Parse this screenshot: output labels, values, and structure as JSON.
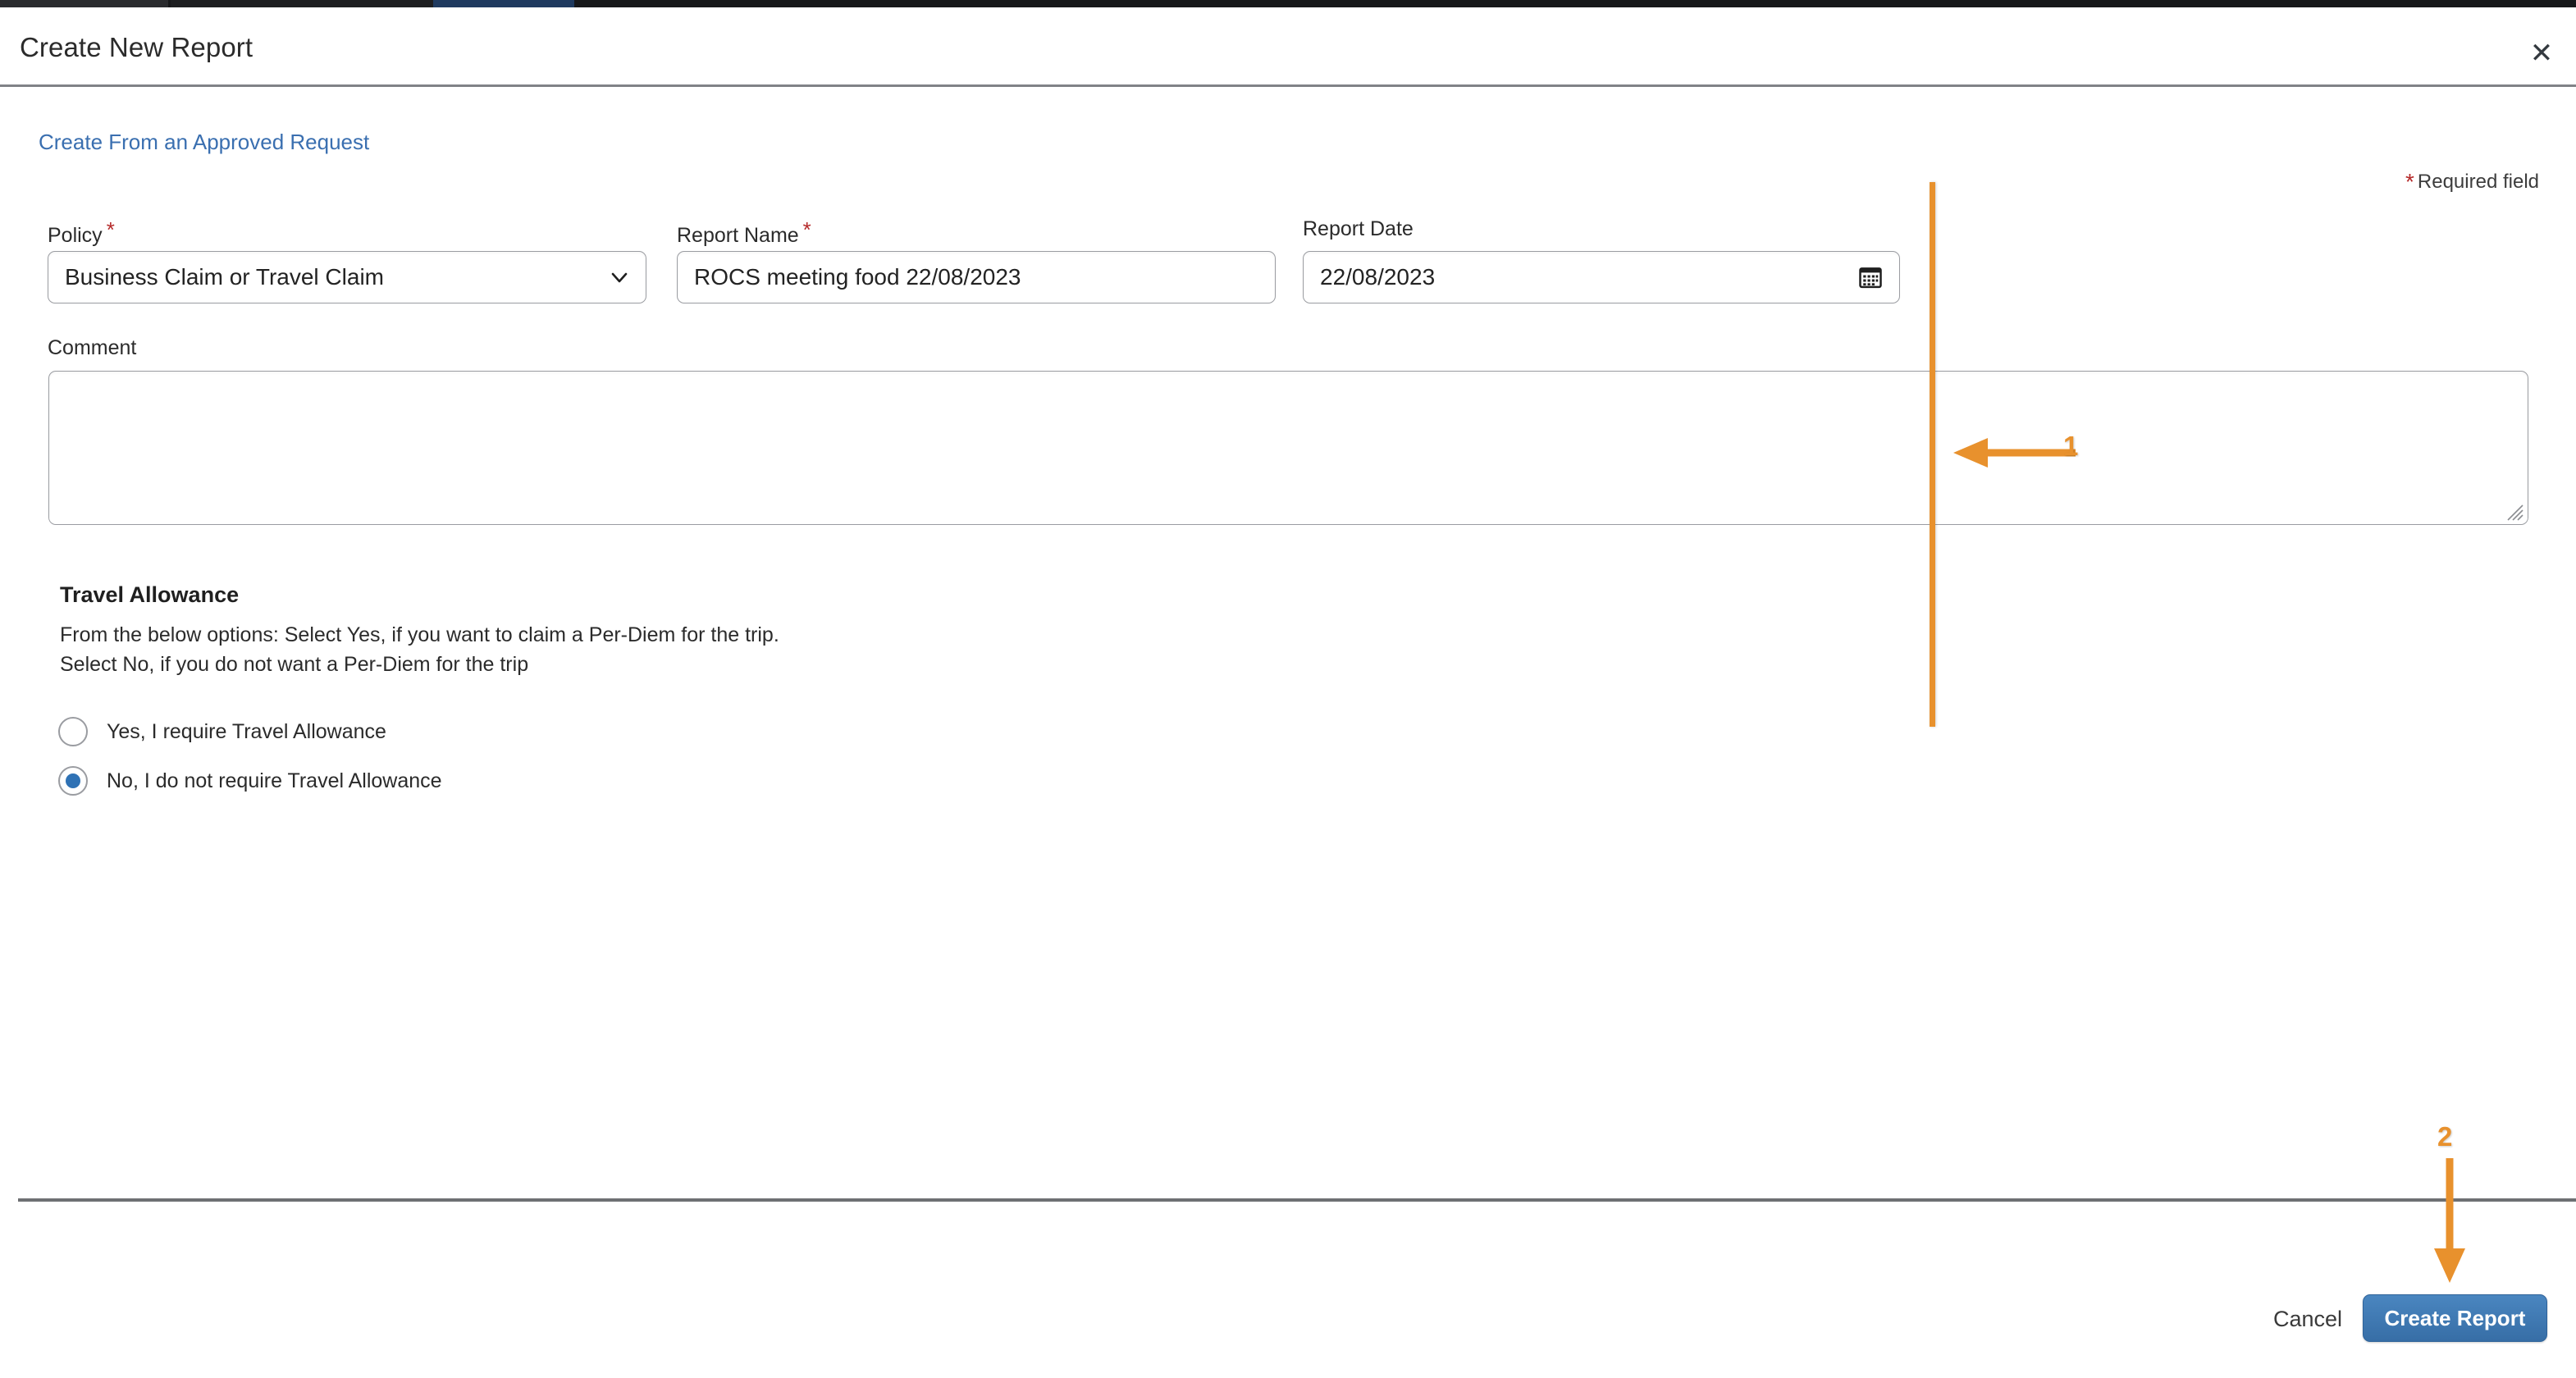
{
  "dialog": {
    "title": "Create New Report",
    "close_icon": "close-icon"
  },
  "body": {
    "approved_request_link": "Create From an Approved Request",
    "required_field_note": "Required field",
    "required_marker": "*"
  },
  "fields": {
    "policy": {
      "label": "Policy",
      "required_marker": "*",
      "value": "Business Claim or Travel Claim",
      "icon": "chevron-down-icon"
    },
    "report_name": {
      "label": "Report Name",
      "required_marker": "*",
      "value": "ROCS meeting food 22/08/2023",
      "placeholder": ""
    },
    "report_date": {
      "label": "Report Date",
      "value": "22/08/2023",
      "icon": "calendar-icon"
    },
    "comment": {
      "label": "Comment",
      "value": "",
      "placeholder": ""
    }
  },
  "travel_allowance": {
    "heading": "Travel Allowance",
    "description_line1": "From the below options: Select Yes, if you want to claim a Per-Diem for the trip.",
    "description_line2": "Select No, if you do not want a Per-Diem for the trip",
    "options": [
      {
        "label": "Yes, I require Travel Allowance",
        "selected": false
      },
      {
        "label": "No, I do not require Travel Allowance",
        "selected": true
      }
    ]
  },
  "footer": {
    "cancel_label": "Cancel",
    "create_label": "Create Report"
  },
  "annotations": {
    "marker_1": "1",
    "marker_2": "2",
    "color": "#e8912d"
  },
  "colors": {
    "link": "#3a6fb0",
    "required": "#b52a2a",
    "primary_button": "#376ea6",
    "radio_selected": "#2f72b5",
    "annotation": "#e8912d"
  }
}
